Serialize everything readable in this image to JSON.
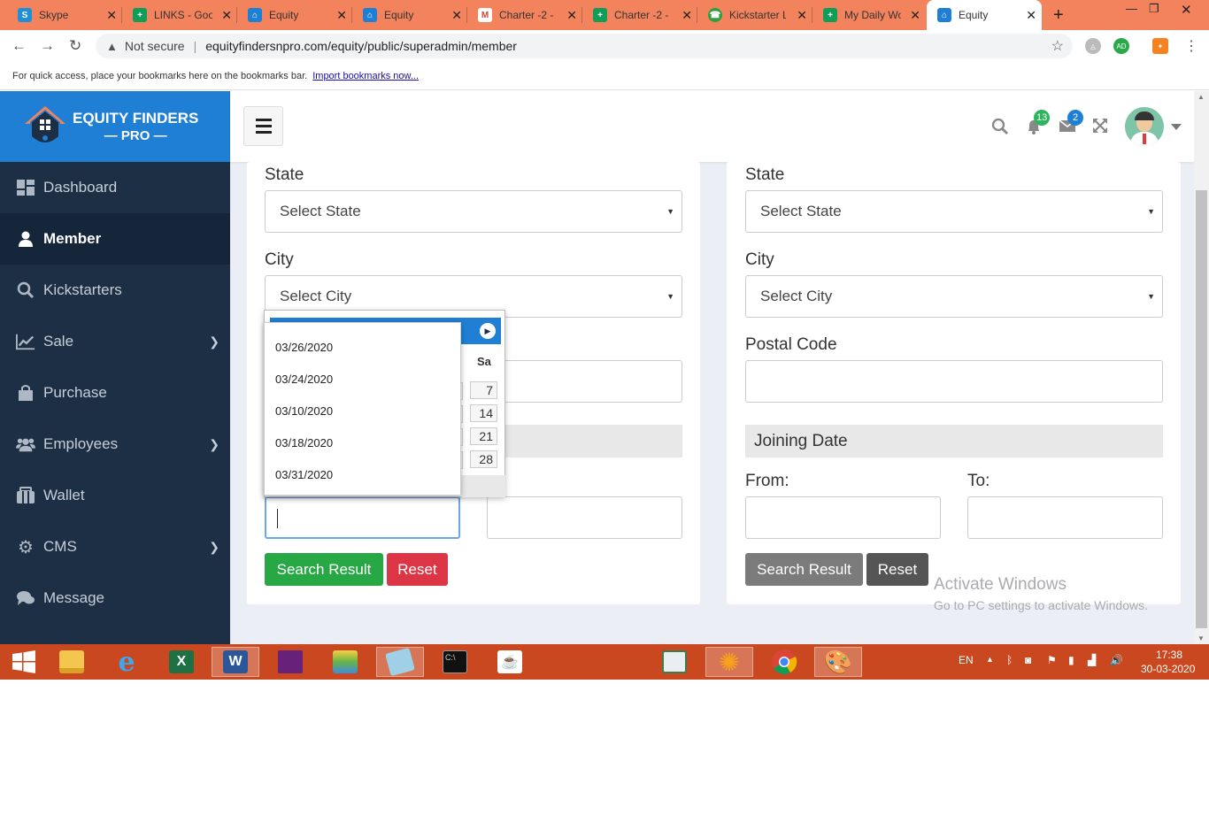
{
  "browser": {
    "tabs": [
      {
        "label": "Skype",
        "icon": "skype-icon",
        "color": "#1e90d8"
      },
      {
        "label": "LINKS - Goo",
        "icon": "sheets-icon",
        "color": "#0f9d58"
      },
      {
        "label": "Equity",
        "icon": "equity-favicon",
        "color": "#1f7fd4"
      },
      {
        "label": "Equity",
        "icon": "equity-favicon",
        "color": "#1f7fd4"
      },
      {
        "label": "Charter -2 -",
        "icon": "gmail-icon",
        "color": "#db4437"
      },
      {
        "label": "Charter -2 -",
        "icon": "sheets-icon",
        "color": "#0f9d58"
      },
      {
        "label": "Kickstarter L",
        "icon": "phone-icon",
        "color": "#2e9e3e"
      },
      {
        "label": "My Daily Wo",
        "icon": "sheets-icon",
        "color": "#0f9d58"
      },
      {
        "label": "Equity",
        "icon": "equity-favicon",
        "color": "#1f7fd4",
        "active": true
      }
    ],
    "security_label": "Not secure",
    "url": "equityfindersnpro.com/equity/public/superadmin/member",
    "bookmarks_hint": "For quick access, place your bookmarks here on the bookmarks bar.",
    "bookmarks_link": "Import bookmarks now...",
    "profile_initials": "AD"
  },
  "app": {
    "logo_line1": "EQUITY FINDERS",
    "logo_line2": "PRO",
    "brand_color": "#1f7fd4",
    "sidebar": [
      {
        "label": "Dashboard",
        "icon": "dashboard-icon"
      },
      {
        "label": "Member",
        "icon": "user-icon",
        "active": true
      },
      {
        "label": "Kickstarters",
        "icon": "search-icon"
      },
      {
        "label": "Sale",
        "icon": "chart-line-icon",
        "has_children": true
      },
      {
        "label": "Purchase",
        "icon": "shopping-bag-icon"
      },
      {
        "label": "Employees",
        "icon": "users-icon",
        "has_children": true
      },
      {
        "label": "Wallet",
        "icon": "wallet-icon"
      },
      {
        "label": "CMS",
        "icon": "gear-icon",
        "has_children": true
      },
      {
        "label": "Message",
        "icon": "comments-icon"
      }
    ],
    "topbar": {
      "notifications_count": "13",
      "messages_count": "2"
    }
  },
  "left_form": {
    "state_label": "State",
    "state_placeholder": "Select State",
    "city_label": "City",
    "city_placeholder": "Select City",
    "to_label_fragment": ":",
    "search_button": "Search Result",
    "reset_button": "Reset",
    "datepicker": {
      "day_header": "Sa",
      "days": [
        "7",
        "14",
        "21",
        "28"
      ]
    },
    "autocomplete": [
      "03/26/2020",
      "03/24/2020",
      "03/10/2020",
      "03/18/2020",
      "03/31/2020"
    ]
  },
  "right_form": {
    "state_label": "State",
    "state_placeholder": "Select State",
    "city_label": "City",
    "city_placeholder": "Select City",
    "postal_label": "Postal Code",
    "joining_header": "Joining Date",
    "from_label": "From:",
    "to_label": "To:",
    "search_button": "Search Result",
    "reset_button": "Reset"
  },
  "watermark": {
    "line1": "Activate Windows",
    "line2": "Go to PC settings to activate Windows."
  },
  "taskbar": {
    "apps": [
      "windows-start-icon",
      "file-explorer-icon",
      "internet-explorer-icon",
      "excel-icon",
      "word-icon",
      "visual-studio-icon",
      "bluestacks-icon",
      "notepad-icon",
      "cmd-icon",
      "java-icon",
      "reader-icon",
      "settings-app-icon",
      "chrome-icon",
      "paint-icon"
    ],
    "language": "EN",
    "time": "17:38",
    "date": "30-03-2020"
  }
}
